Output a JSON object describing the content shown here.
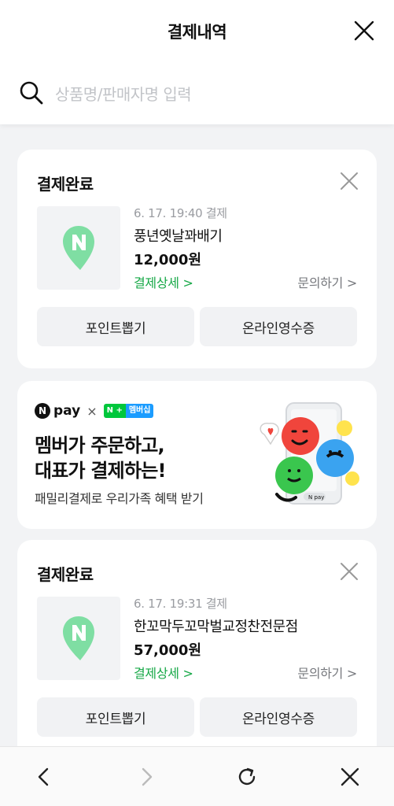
{
  "header": {
    "title": "결제내역",
    "search_placeholder": "상품명/판매자명 입력"
  },
  "orders": [
    {
      "status": "결제완료",
      "datetime": "6. 17. 19:40 결제",
      "shop": "풍년옛날꽈배기",
      "price": "12,000원",
      "detail_link": "결제상세 >",
      "inquiry_link": "문의하기 >",
      "button_points": "포인트뽑기",
      "button_receipt": "온라인영수증"
    },
    {
      "status": "결제완료",
      "datetime": "6. 17. 19:31 결제",
      "shop": "한꼬막두꼬막벌교정찬전문점",
      "price": "57,000원",
      "detail_link": "결제상세 >",
      "inquiry_link": "문의하기 >",
      "button_points": "포인트뽑기",
      "button_receipt": "온라인영수증"
    }
  ],
  "banner": {
    "brand_n": "N",
    "brand_pay": "pay",
    "brand_times": "×",
    "membership_n": "N +",
    "membership_label": "멤버십",
    "headline_1": "멤버가 주문하고,",
    "headline_2": "대표가 결제하는!",
    "subtext": "패밀리결제로 우리가족 혜택 받기",
    "npay_small": "N pay"
  },
  "bottom_nav": {
    "back_icon": "chevron-left-icon",
    "forward_icon": "chevron-right-icon",
    "reload_icon": "reload-icon",
    "close_icon": "close-icon"
  },
  "colors": {
    "accent_green": "#17a847",
    "background": "#f2f3f5",
    "logo_green": "#5fd38a"
  }
}
